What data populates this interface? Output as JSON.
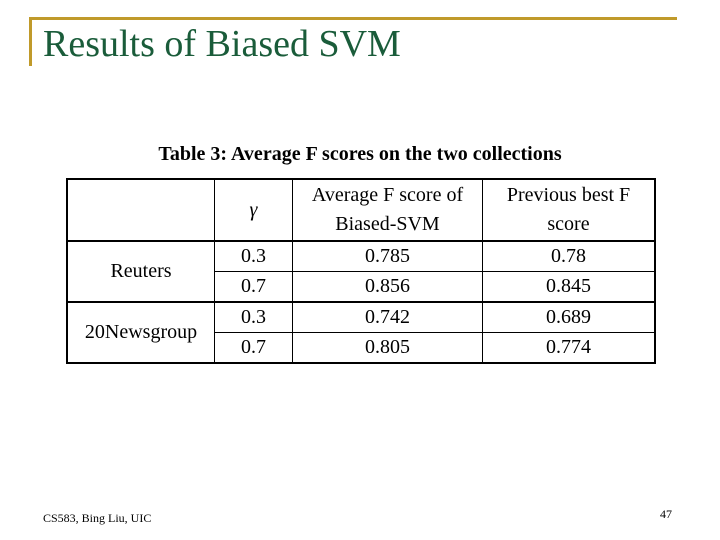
{
  "slide": {
    "title": "Results of Biased SVM",
    "accent_color": "#c09a2a",
    "title_color": "#1a5c3a"
  },
  "table": {
    "caption": "Table 3: Average F scores on the two collections",
    "headers": [
      "",
      "γ",
      "Average F score of Biased-SVM",
      "Previous best F score"
    ],
    "header_lines": {
      "col2": [
        "Average F score of",
        "Biased-SVM"
      ],
      "col3": [
        "Previous best F",
        "score"
      ]
    },
    "groups": [
      {
        "collection": "Reuters",
        "rows": [
          {
            "gamma": "0.3",
            "biased_svm": "0.785",
            "previous_best": "0.78"
          },
          {
            "gamma": "0.7",
            "biased_svm": "0.856",
            "previous_best": "0.845"
          }
        ]
      },
      {
        "collection": "20Newsgroup",
        "rows": [
          {
            "gamma": "0.3",
            "biased_svm": "0.742",
            "previous_best": "0.689"
          },
          {
            "gamma": "0.7",
            "biased_svm": "0.805",
            "previous_best": "0.774"
          }
        ]
      }
    ]
  },
  "footer": {
    "left": "CS583, Bing Liu, UIC",
    "page_number": "47"
  }
}
